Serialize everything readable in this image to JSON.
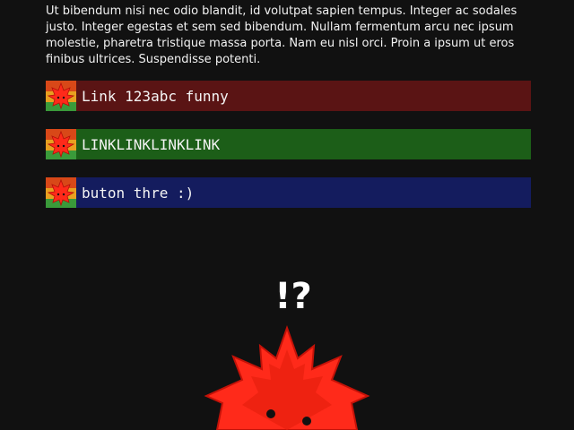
{
  "intro_text": "Ut bibendum nisi nec odio blandit, id volutpat sapien tempus. Integer ac sodales justo. Integer egestas et sem sed bibendum. Nullam fermentum arcu nec ipsum molestie, pharetra tristique massa porta. Nam eu nisl orci. Proin a ipsum ut eros finibus ultrices. Suspendisse potenti.",
  "links": [
    {
      "label": "Link 123abc funny",
      "color": "#5a1414",
      "icon": "maple-leaf-icon"
    },
    {
      "label": "LINKLINKLINKLINK",
      "color": "#1c5e18",
      "icon": "maple-leaf-icon"
    },
    {
      "label": "buton thre :)",
      "color": "#141c5e",
      "icon": "maple-leaf-icon"
    }
  ],
  "mascot": {
    "exclamation": "!?",
    "icon": "maple-leaf-mascot",
    "color": "#ff2a1a"
  }
}
